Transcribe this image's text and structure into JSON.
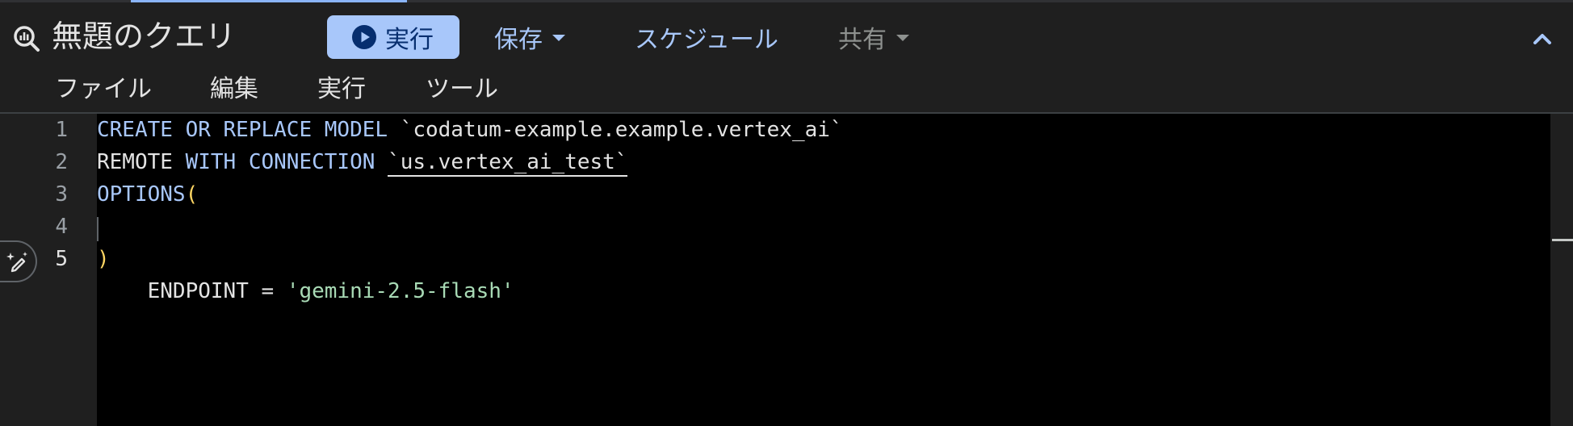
{
  "header": {
    "title": "無題のクエリ",
    "run_label": "実行",
    "save_label": "保存",
    "schedule_label": "スケジュール",
    "share_label": "共有"
  },
  "menu": [
    "ファイル",
    "編集",
    "実行",
    "ツール"
  ],
  "editor": {
    "line_numbers": [
      "1",
      "2",
      "3",
      "4",
      "5"
    ],
    "current_line": 5,
    "lines": [
      [
        {
          "t": "CREATE OR REPLACE MODEL",
          "c": "kw"
        },
        {
          "t": " `codatum-example.example.vertex_ai`",
          "c": "plain"
        }
      ],
      [
        {
          "t": "REMOTE ",
          "c": "plain"
        },
        {
          "t": "WITH CONNECTION",
          "c": "kw"
        },
        {
          "t": " ",
          "c": "plain"
        },
        {
          "t": "`us.vertex_ai_test`",
          "c": "ul"
        }
      ],
      [
        {
          "t": "OPTIONS",
          "c": "kw"
        },
        {
          "t": "(",
          "c": "paren"
        }
      ],
      [
        {
          "t": "  ENDPOINT = ",
          "c": "plain"
        },
        {
          "t": "'gemini-2.5-flash'",
          "c": "str"
        }
      ],
      [
        {
          "t": ")",
          "c": "paren"
        }
      ]
    ]
  },
  "icons": {
    "query": "query-search-icon",
    "run": "play-circle-icon",
    "collapse": "chevron-up-icon",
    "ai_assist": "magic-pen-icon"
  },
  "colors": {
    "accent": "#a8c7fa",
    "editor_bg": "#000000",
    "chrome_bg": "#1f1f1f",
    "keyword": "#a8c7fa",
    "string": "#a8dab5",
    "paren": "#fdd663"
  }
}
